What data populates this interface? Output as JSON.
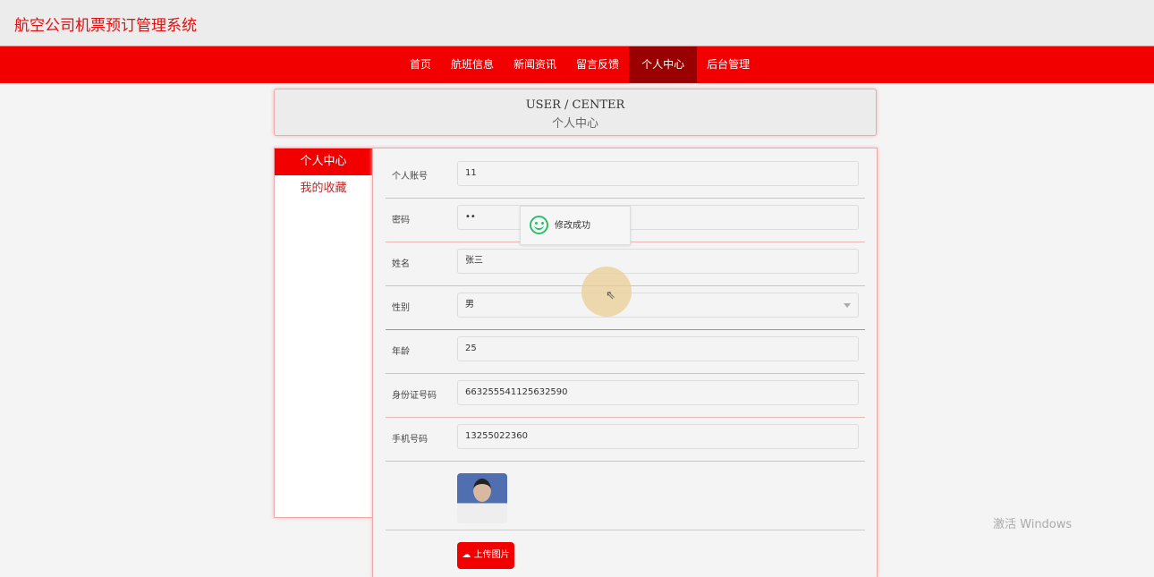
{
  "header": {
    "title": "航空公司机票预订管理系统"
  },
  "nav": {
    "items": [
      "首页",
      "航班信息",
      "新闻资讯",
      "留言反馈",
      "个人中心",
      "后台管理"
    ],
    "active": "个人中心"
  },
  "banner": {
    "en": "USER / CENTER",
    "cn": "个人中心"
  },
  "sidebar": {
    "items": [
      "个人中心",
      "我的收藏"
    ]
  },
  "form": {
    "fields": [
      {
        "label": "个人账号",
        "value": "11"
      },
      {
        "label": "密码",
        "value": "••"
      },
      {
        "label": "姓名",
        "value": "张三"
      },
      {
        "label": "性别",
        "value": "男"
      },
      {
        "label": "年龄",
        "value": "25"
      },
      {
        "label": "身份证号码",
        "value": "663255541125632590"
      },
      {
        "label": "手机号码",
        "value": "13255022360"
      }
    ],
    "upload_label": "上传图片"
  },
  "toast": {
    "text": "修改成功"
  },
  "watermark": "激活 Windows",
  "colors": {
    "brand": "#f20000",
    "nav_active": "#9b0000",
    "success": "#2cbf6b"
  }
}
